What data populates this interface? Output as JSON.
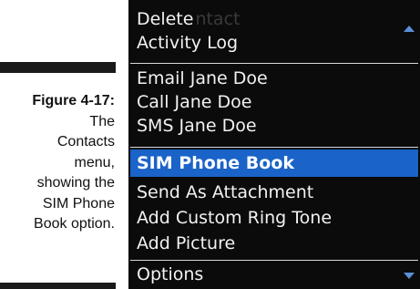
{
  "caption": {
    "figure_label": "Figure 4-17:",
    "lines": [
      "The",
      "Contacts",
      "menu,",
      "showing the",
      "SIM Phone",
      "Book option."
    ]
  },
  "menu": {
    "items": [
      {
        "label": "Delete",
        "ghost": "ntact"
      },
      {
        "label": "Activity Log"
      },
      {
        "label": "Email Jane Doe"
      },
      {
        "label": "Call Jane Doe"
      },
      {
        "label": "SMS Jane Doe"
      },
      {
        "label": "SIM Phone Book",
        "selected": true
      },
      {
        "label": "Send As Attachment"
      },
      {
        "label": "Add Custom Ring Tone"
      },
      {
        "label": "Add Picture"
      },
      {
        "label": "Options"
      }
    ],
    "colors": {
      "background": "#0b0b0b",
      "selected": "#1a63c9",
      "text": "#f2f2f2",
      "scroll_arrow": "#5b8fd8"
    }
  }
}
